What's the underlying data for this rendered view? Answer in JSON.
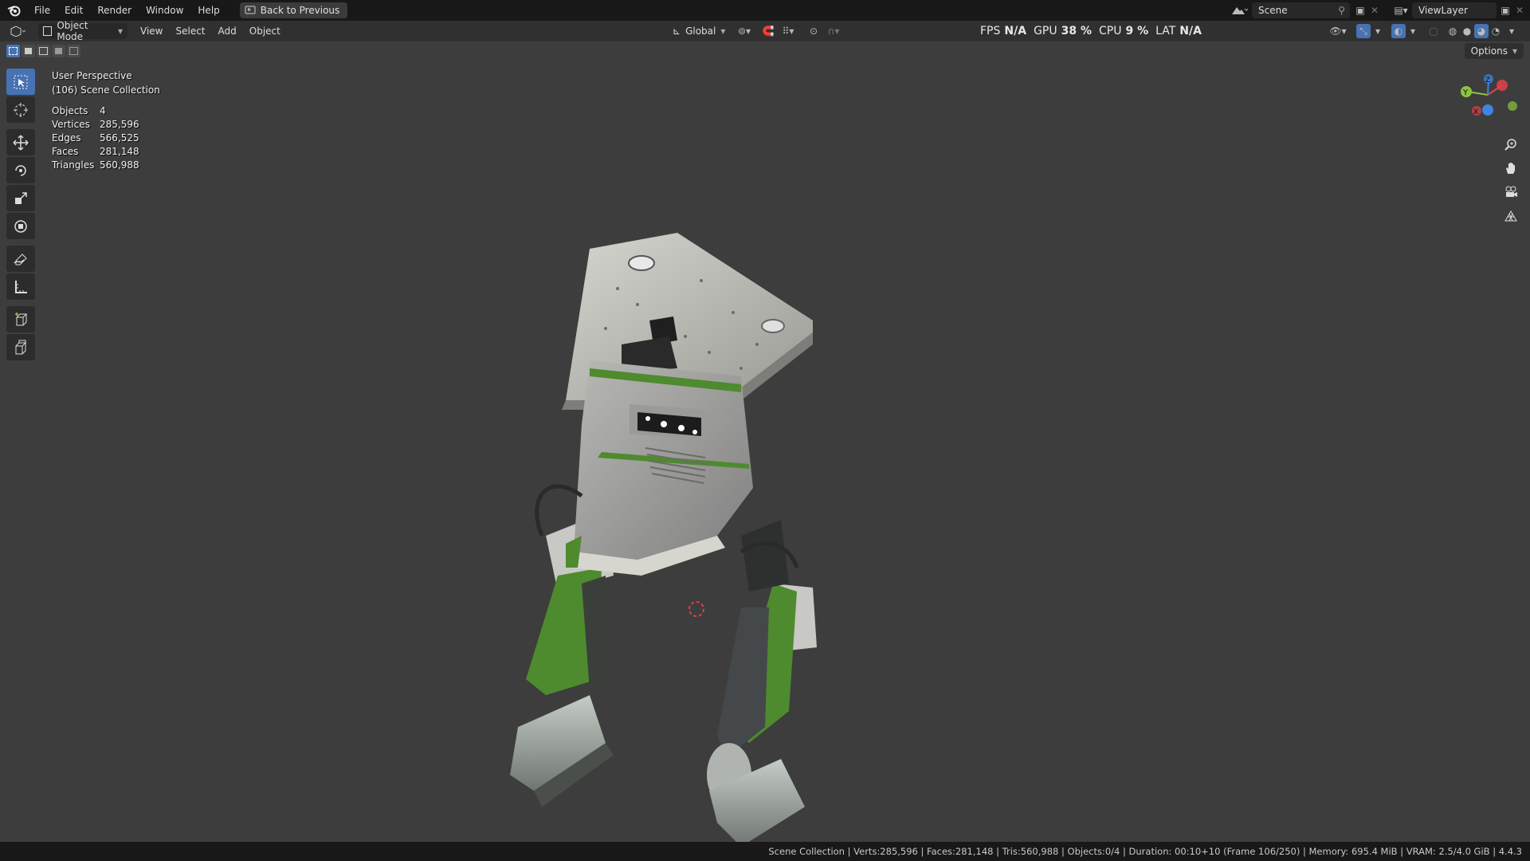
{
  "menu": {
    "items": [
      "File",
      "Edit",
      "Render",
      "Window",
      "Help"
    ],
    "back_button": "Back to Previous"
  },
  "top_right": {
    "scene": "Scene",
    "view_layer": "ViewLayer"
  },
  "viewport_header": {
    "mode": "Object Mode",
    "menus": [
      "View",
      "Select",
      "Add",
      "Object"
    ],
    "orientation": "Global",
    "options": "Options"
  },
  "perf": {
    "fps_label": "FPS",
    "fps_value": "N/A",
    "gpu_label": "GPU",
    "gpu_value": "38 %",
    "cpu_label": "CPU",
    "cpu_value": "9 %",
    "lat_label": "LAT",
    "lat_value": "N/A"
  },
  "overlay": {
    "view_name": "User Perspective",
    "collection": "(106) Scene Collection"
  },
  "stats": [
    {
      "label": "Objects",
      "value": "4"
    },
    {
      "label": "Vertices",
      "value": "285,596"
    },
    {
      "label": "Edges",
      "value": "566,525"
    },
    {
      "label": "Faces",
      "value": "281,148"
    },
    {
      "label": "Triangles",
      "value": "560,988"
    }
  ],
  "gizmo": {
    "x": "X",
    "y": "Y",
    "z": "Z"
  },
  "statusbar": "Scene Collection | Verts:285,596 | Faces:281,148 | Tris:560,988 | Objects:0/4 | Duration: 00:10+10 (Frame 106/250) | Memory: 695.4 MiB | VRAM: 2.5/4.0 GiB | 4.4.3",
  "colors": {
    "accent": "#4772b3",
    "viewport_bg": "#3d3d3d",
    "robot_green": "#4e8a2e",
    "gizmo_x": "#e2424b",
    "gizmo_y": "#8cc43f",
    "gizmo_z": "#3e85e0"
  },
  "icons": {
    "tools": [
      "select-box-icon",
      "cursor-icon",
      "move-icon",
      "rotate-icon",
      "scale-icon",
      "transform-icon",
      "annotate-icon",
      "measure-icon",
      "add-cube-icon",
      "extrude-cube-icon"
    ],
    "nav": [
      "zoom-icon",
      "pan-hand-icon",
      "camera-icon",
      "grid-ortho-icon"
    ]
  }
}
